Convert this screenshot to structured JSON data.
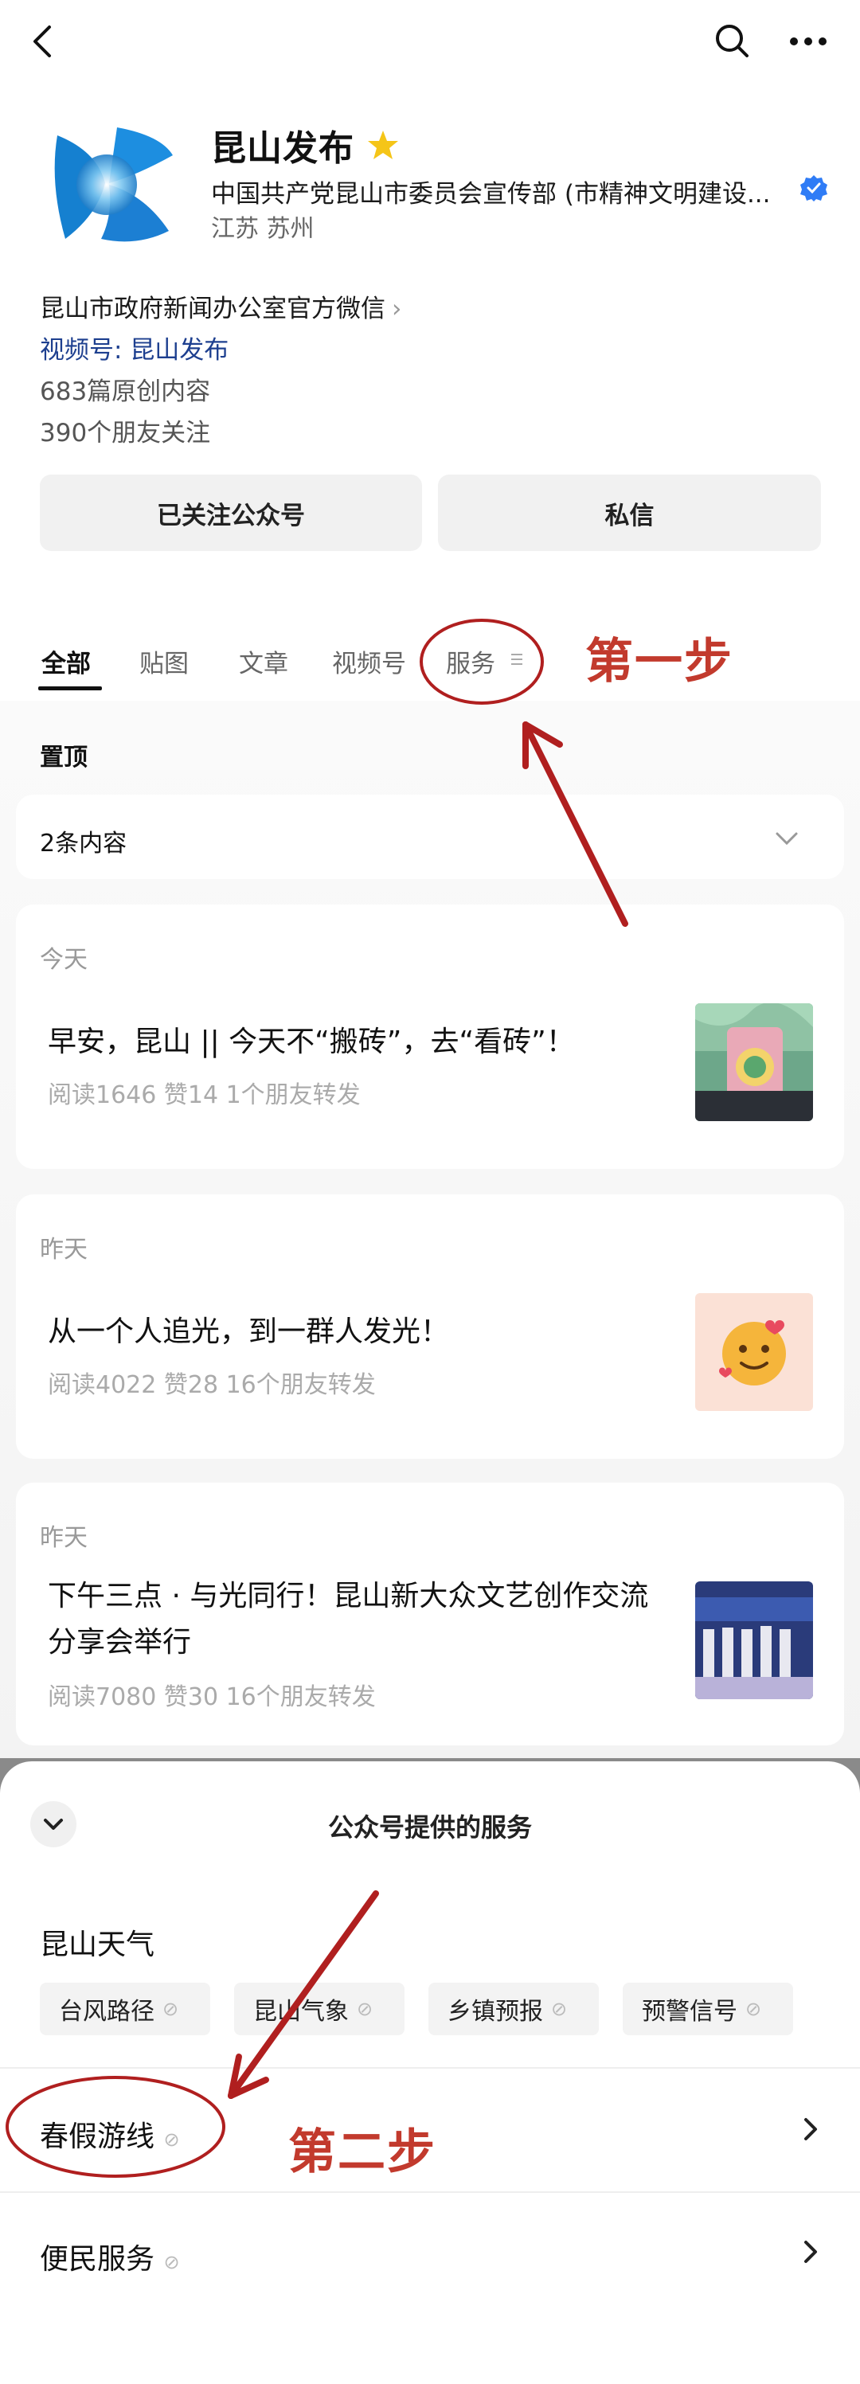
{
  "top_bar": {
    "back_icon": "chevron-left-icon",
    "search_icon": "search-icon",
    "more_icon": "more-dots-icon"
  },
  "profile": {
    "name": "昆山发布",
    "org": "中国共产党昆山市委员会宣传部 (市精神文明建设...",
    "location": "江苏 苏州",
    "desc": "昆山市政府新闻办公室官方微信",
    "video_account": "视频号: 昆山发布",
    "original_count": "683篇原创内容",
    "friends_follow": "390个朋友关注"
  },
  "buttons": {
    "follow": "已关注公众号",
    "message": "私信"
  },
  "tabs": [
    "全部",
    "贴图",
    "文章",
    "视频号",
    "服务"
  ],
  "annotations": {
    "step1": "第一步",
    "step2": "第二步"
  },
  "pinned": {
    "label": "置顶",
    "summary": "2条内容"
  },
  "articles": [
    {
      "day": "今天",
      "title": "早安，昆山 || 今天不“搬砖”，去“看砖”！",
      "meta": "阅读1646  赞14  1个朋友转发"
    },
    {
      "day": "昨天",
      "title": "从一个人追光，到一群人发光！",
      "meta": "阅读4022  赞28  16个朋友转发"
    },
    {
      "day": "昨天",
      "title": "下午三点 · 与光同行！昆山新大众文艺创作交流分享会举行",
      "meta": "阅读7080  赞30  16个朋友转发"
    }
  ],
  "sheet": {
    "title": "公众号提供的服务",
    "weather": "昆山天气",
    "chips": [
      "台风路径",
      "昆山气象",
      "乡镇预报",
      "预警信号"
    ],
    "rows": [
      "春假游线",
      "便民服务"
    ]
  },
  "colors": {
    "annotation_red": "#c23a2d",
    "link_blue": "#1d3f8f",
    "verified_blue": "#2f7cf6",
    "star": "#f5c518"
  }
}
